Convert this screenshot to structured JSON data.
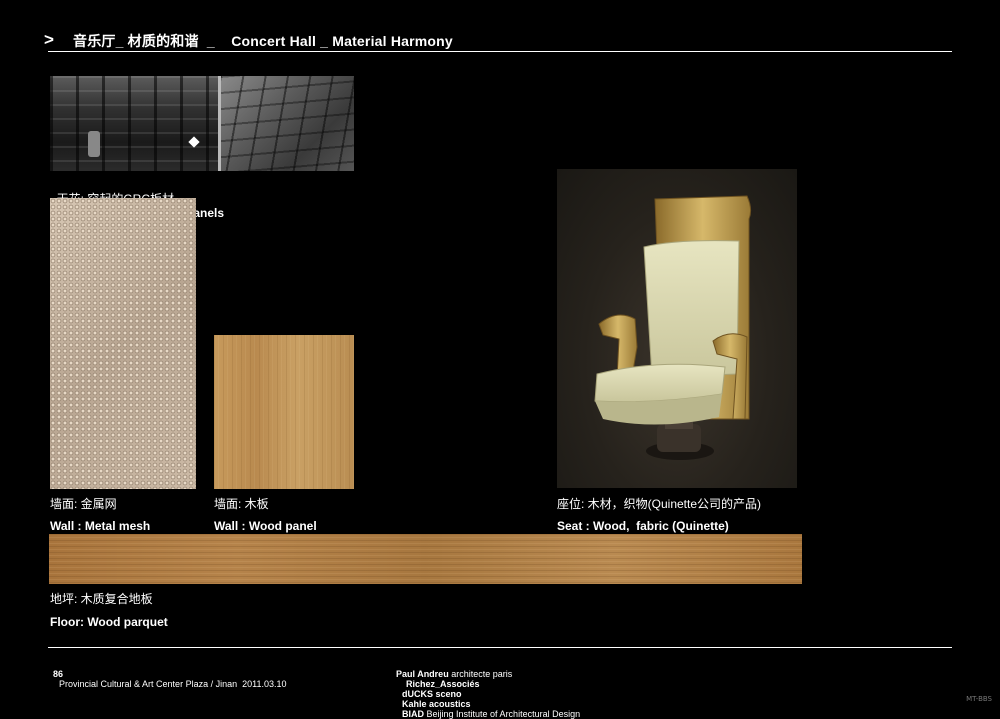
{
  "header": {
    "arrow": ">",
    "title": "音乐厅_ 材质的和谐  _    Concert Hall _ Material Harmony"
  },
  "ceiling": {
    "caption_cn": "天花: 突起的GRC板材",
    "caption_en": "Ceiling: Bulged GRC panels"
  },
  "wall_mesh": {
    "caption_cn": "墙面: 金属网",
    "caption_en": "Wall : Metal mesh"
  },
  "wall_wood": {
    "caption_cn": "墙面: 木板",
    "caption_en": "Wall : Wood panel"
  },
  "seat": {
    "caption_cn": "座位: 木材，织物(Quinette公司的产品)",
    "caption_en": "Seat : Wood,  fabric (Quinette)"
  },
  "floor": {
    "caption_cn": "地坪: 木质复合地板",
    "caption_en": "Floor: Wood parquet"
  },
  "footer": {
    "page_number": "86",
    "project": "Provincial Cultural & Art Center Plaza / Jinan  2011.03.10",
    "credit_1_bold": "Paul Andreu",
    "credit_1_rest": " architecte paris",
    "credit_2": "Richez_Associés",
    "credit_3": "dUCKS sceno",
    "credit_4": "Kahle acoustics",
    "credit_5_bold": "BIAD",
    "credit_5_rest": " Beijing Institute of Architectural Design"
  },
  "watermark": "MT-BBS"
}
